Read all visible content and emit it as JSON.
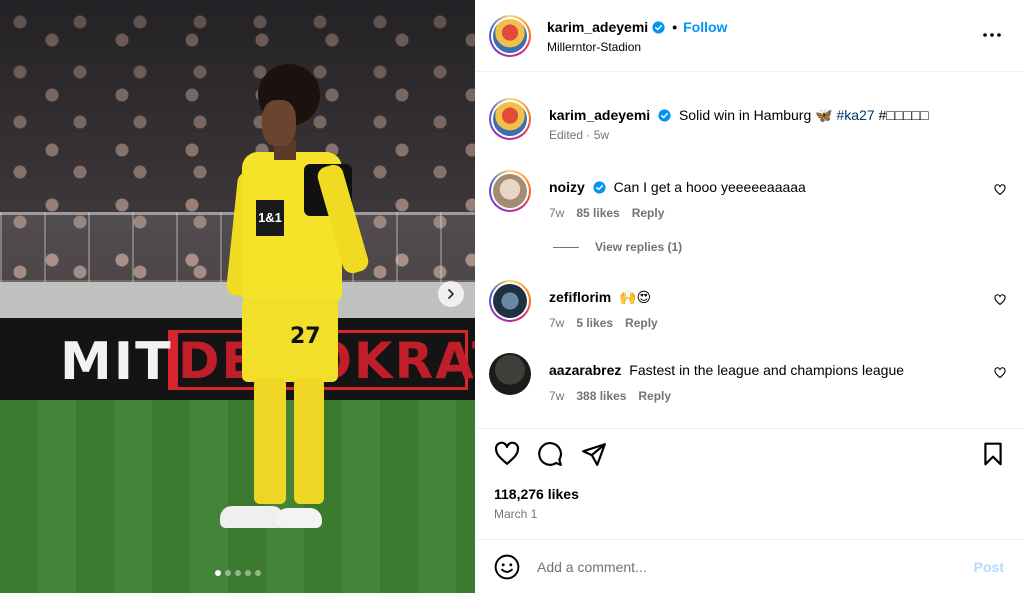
{
  "post": {
    "author": {
      "username": "karim_adeyemi",
      "verified": true,
      "follow_label": "Follow",
      "separator": "•",
      "location": "Millerntor-Stadion"
    },
    "caption": {
      "text": "Solid win in Hamburg 🦋",
      "hashtags": [
        "#ka27",
        "#□□□□□"
      ],
      "meta": "Edited · 5w"
    },
    "image": {
      "board_text_left": "MIT",
      "board_text_red": "DEMOKRATIE",
      "jersey_sponsor": "1&1",
      "jersey_number": "27",
      "carousel_count": 5,
      "carousel_active_index": 0
    },
    "likes_text": "118,276 likes",
    "date_text": "March 1"
  },
  "comments": [
    {
      "username": "noizy",
      "verified": true,
      "text": "Can I get a hooo yeeeeeaaaaa",
      "age": "7w",
      "likes": "85 likes",
      "reply_label": "Reply",
      "view_replies": "View replies (1)"
    },
    {
      "username": "zefiflorim",
      "verified": false,
      "text": "🙌😍",
      "age": "7w",
      "likes": "5 likes",
      "reply_label": "Reply"
    },
    {
      "username": "aazarabrez",
      "verified": false,
      "text": "Fastest in the league and champions league",
      "age": "7w",
      "likes": "388 likes",
      "reply_label": "Reply"
    }
  ],
  "composer": {
    "placeholder": "Add a comment...",
    "post_label": "Post"
  },
  "colors": {
    "accent_blue": "#0095f6",
    "hashtag": "#00376b",
    "muted": "#737373",
    "post_disabled": "#b3dbff",
    "kit_yellow": "#f5e32a"
  },
  "icons": {
    "verified": "verified-badge-icon",
    "more": "more-options-icon",
    "heart": "heart-icon",
    "comment": "comment-icon",
    "share": "share-icon",
    "save": "bookmark-icon",
    "emoji": "emoji-icon",
    "next": "chevron-right-icon"
  }
}
